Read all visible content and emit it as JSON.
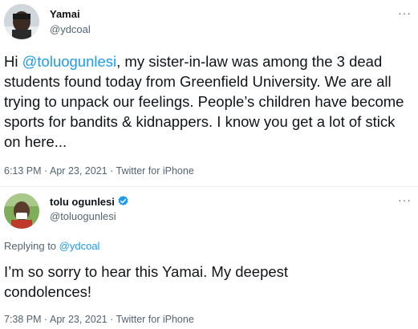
{
  "colors": {
    "accent": "#1d9bf0",
    "text": "#0f1419",
    "muted": "#536471",
    "divider": "#e6ecf0"
  },
  "tweet1": {
    "display_name": "Yamai",
    "handle": "@ydcoal",
    "avatar_icon": "avatar-photo",
    "text_before": "Hi ",
    "mention": "@toluogunlesi",
    "text_after": ", my sister-in-law was among the 3 dead students  found today from Greenfield University. We are all trying to unpack our feelings. People’s children have become sports for bandits & kidnappers. I know you get a lot of stick on here...",
    "time": "6:13 PM",
    "date": "Apr 23, 2021",
    "source": "Twitter for iPhone",
    "sep": "·",
    "more": "···"
  },
  "tweet2": {
    "display_name": "tolu ogunlesi",
    "verified_icon": "verified-badge-icon",
    "handle": "@toluogunlesi",
    "avatar_icon": "avatar-photo",
    "replying_prefix": "Replying to ",
    "replying_to": "@ydcoal",
    "text": "I’m so sorry to hear this Yamai. My deepest condolences!",
    "time": "7:38 PM",
    "date": "Apr 23, 2021",
    "source": "Twitter for iPhone",
    "sep": "·",
    "more": "···"
  }
}
